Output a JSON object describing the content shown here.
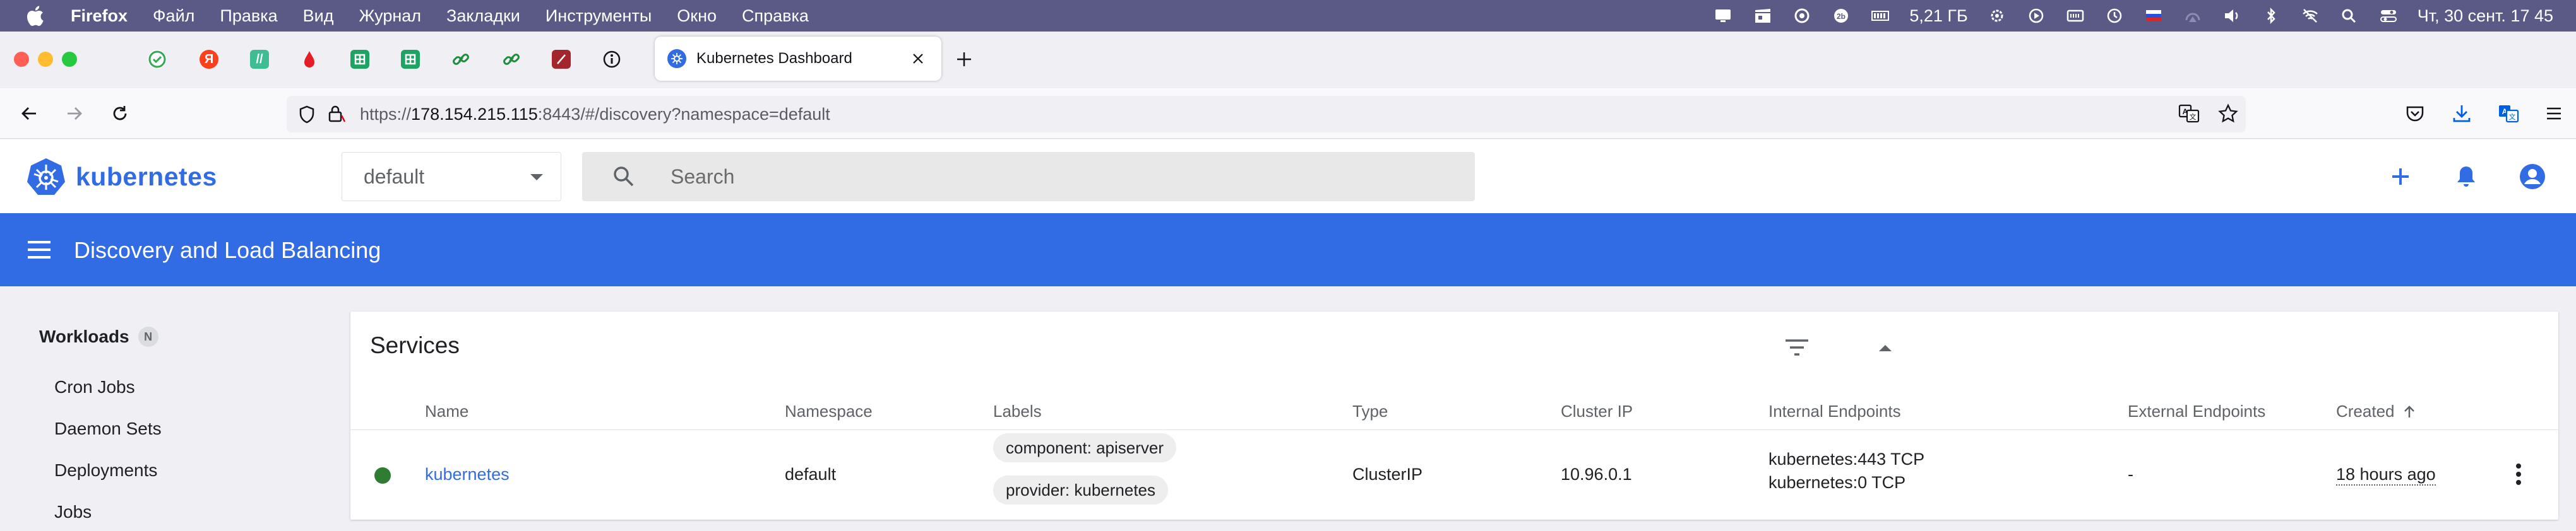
{
  "menubar": {
    "items": [
      "Firefox",
      "Файл",
      "Правка",
      "Вид",
      "Журнал",
      "Закладки",
      "Инструменты",
      "Окно",
      "Справка"
    ],
    "memory": "5,21 ГБ",
    "datetime": "Чт, 30 сент.  17 45"
  },
  "browser": {
    "tab_title": "Kubernetes Dashboard",
    "url_prefix": "https://",
    "url_host": "178.154.215.115",
    "url_rest": ":8443/#/discovery?namespace=default",
    "pinned_tabs": [
      "check-icon",
      "yandex-icon",
      "slash-icon",
      "drop-icon",
      "sheets-icon",
      "sheets-icon",
      "link-icon",
      "link-icon",
      "pen-icon",
      "info-icon"
    ]
  },
  "header": {
    "brand": "kubernetes",
    "namespace": "default",
    "search_placeholder": "Search"
  },
  "toolbar": {
    "title": "Discovery and Load Balancing"
  },
  "sidebar": {
    "section": "Workloads",
    "badge": "N",
    "items": [
      "Cron Jobs",
      "Daemon Sets",
      "Deployments",
      "Jobs"
    ]
  },
  "services": {
    "title": "Services",
    "columns": {
      "name": "Name",
      "namespace": "Namespace",
      "labels": "Labels",
      "type": "Type",
      "cluster_ip": "Cluster IP",
      "internal": "Internal Endpoints",
      "external": "External Endpoints",
      "created": "Created"
    },
    "rows": [
      {
        "status": "running",
        "name": "kubernetes",
        "namespace": "default",
        "labels": [
          "component: apiserver",
          "provider: kubernetes"
        ],
        "type": "ClusterIP",
        "cluster_ip": "10.96.0.1",
        "internal": [
          "kubernetes:443 TCP",
          "kubernetes:0 TCP"
        ],
        "external": "-",
        "created": "18 hours ago"
      }
    ]
  },
  "colors": {
    "brand_blue": "#326ce5",
    "menubar": "#5b5a86",
    "status_green": "#2e7d32"
  }
}
